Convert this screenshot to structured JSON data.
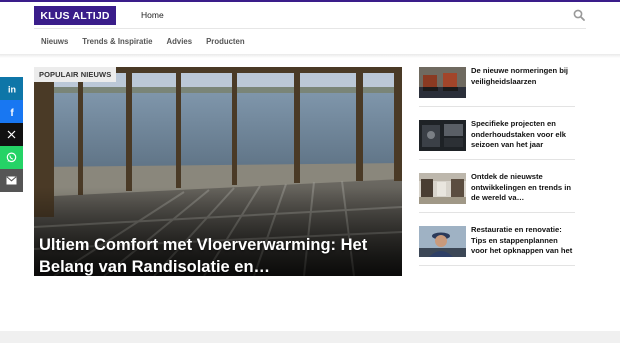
{
  "brand": {
    "logo_text": "KLUS ALTIJD",
    "accent_color": "#3a1d8a"
  },
  "header": {
    "home_label": "Home",
    "search_icon": "search-icon"
  },
  "nav": {
    "items": [
      {
        "label": "Nieuws"
      },
      {
        "label": "Trends & Inspiratie"
      },
      {
        "label": "Advies"
      },
      {
        "label": "Producten"
      }
    ]
  },
  "share": {
    "buttons": [
      {
        "icon": "linkedin-icon",
        "color": "#0e76a8"
      },
      {
        "icon": "facebook-icon",
        "color": "#1877f2"
      },
      {
        "icon": "x-icon",
        "color": "#111111"
      },
      {
        "icon": "whatsapp-icon",
        "color": "#25d366"
      },
      {
        "icon": "mail-icon",
        "color": "#555555"
      }
    ]
  },
  "hero": {
    "badge": "POPULAIR NIEUWS",
    "title": "Ultiem Comfort met Vloerverwarming: Het Belang van Randisolatie en…"
  },
  "sidebar": {
    "articles": [
      {
        "title": "De nieuwe normeringen bij veiligheidslaarzen"
      },
      {
        "title": "Specifieke projecten en onderhoudstaken voor elk seizoen van het jaar"
      },
      {
        "title": "Ontdek de nieuwste ontwikkelingen en trends in de wereld va…"
      },
      {
        "title": "Restauratie en renovatie: Tips en stappenplannen voor het opknappen van het"
      }
    ]
  }
}
